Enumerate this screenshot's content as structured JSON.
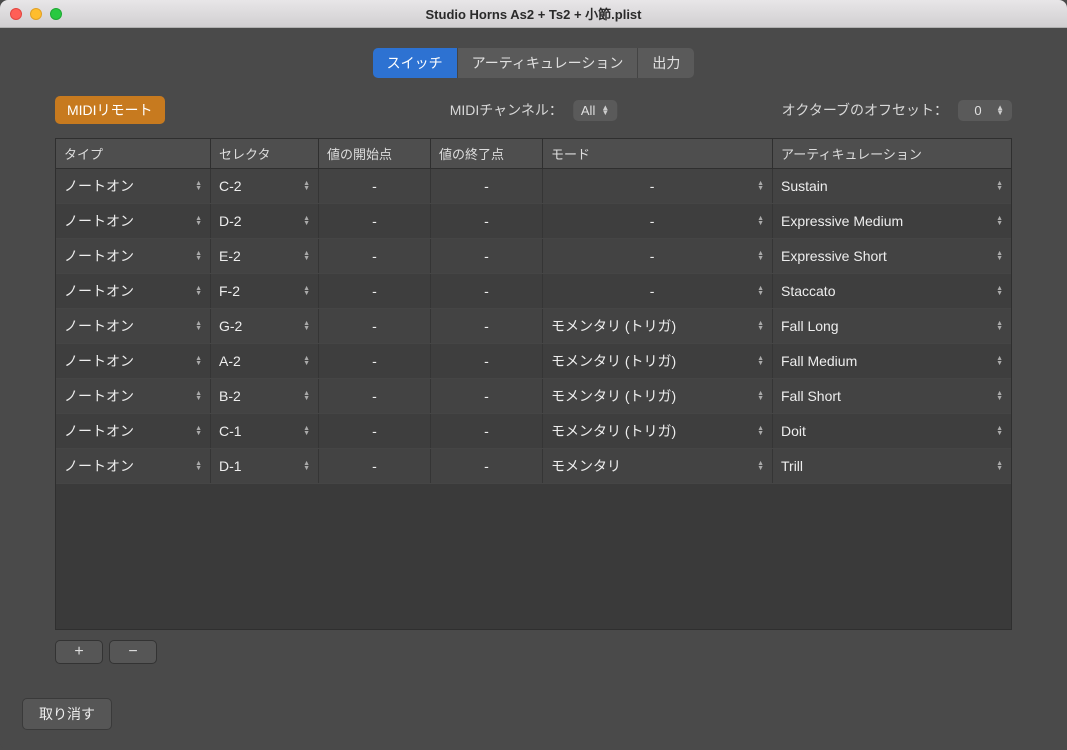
{
  "window": {
    "title": "Studio Horns As2 + Ts2 + 小節.plist"
  },
  "tabs": {
    "switch": "スイッチ",
    "articulation": "アーティキュレーション",
    "output": "出力"
  },
  "toolbar": {
    "midi_remote": "MIDIリモート",
    "midi_channel_label": "MIDIチャンネル：",
    "midi_channel_value": "All",
    "octave_label": "オクターブのオフセット：",
    "octave_value": "0"
  },
  "columns": {
    "type": "タイプ",
    "selector": "セレクタ",
    "start": "値の開始点",
    "end": "値の終了点",
    "mode": "モード",
    "articulation": "アーティキュレーション"
  },
  "rows": [
    {
      "type": "ノートオン",
      "selector": "C-2",
      "start": "-",
      "end": "-",
      "mode": "-",
      "articulation": "Sustain"
    },
    {
      "type": "ノートオン",
      "selector": "D-2",
      "start": "-",
      "end": "-",
      "mode": "-",
      "articulation": "Expressive Medium"
    },
    {
      "type": "ノートオン",
      "selector": "E-2",
      "start": "-",
      "end": "-",
      "mode": "-",
      "articulation": "Expressive Short"
    },
    {
      "type": "ノートオン",
      "selector": "F-2",
      "start": "-",
      "end": "-",
      "mode": "-",
      "articulation": "Staccato"
    },
    {
      "type": "ノートオン",
      "selector": "G-2",
      "start": "-",
      "end": "-",
      "mode": "モメンタリ (トリガ)",
      "articulation": "Fall Long"
    },
    {
      "type": "ノートオン",
      "selector": "A-2",
      "start": "-",
      "end": "-",
      "mode": "モメンタリ (トリガ)",
      "articulation": "Fall Medium"
    },
    {
      "type": "ノートオン",
      "selector": "B-2",
      "start": "-",
      "end": "-",
      "mode": "モメンタリ (トリガ)",
      "articulation": "Fall Short"
    },
    {
      "type": "ノートオン",
      "selector": "C-1",
      "start": "-",
      "end": "-",
      "mode": "モメンタリ (トリガ)",
      "articulation": "Doit"
    },
    {
      "type": "ノートオン",
      "selector": "D-1",
      "start": "-",
      "end": "-",
      "mode": "モメンタリ",
      "articulation": "Trill"
    }
  ],
  "footer": {
    "add": "+",
    "remove": "−",
    "cancel": "取り消す"
  }
}
